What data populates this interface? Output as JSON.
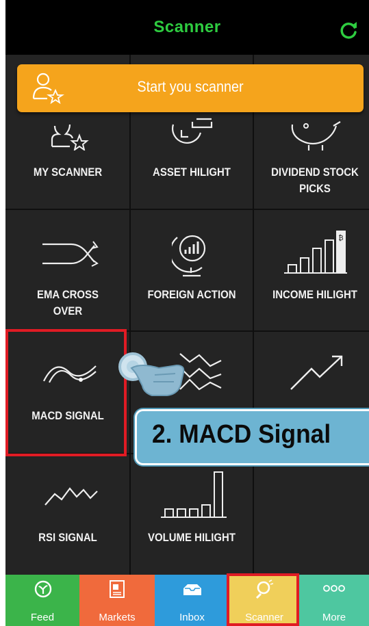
{
  "header": {
    "title": "Scanner"
  },
  "start_button": {
    "label": "Start you scanner"
  },
  "grid": {
    "items": [
      {
        "id": "my_scanner",
        "label": "MY SCANNER"
      },
      {
        "id": "asset_hilight",
        "label": "ASSET HILIGHT"
      },
      {
        "id": "dividend_stock_picks",
        "label_line1": "DIVIDEND STOCK",
        "label_line2": "PICKS"
      },
      {
        "id": "ema_cross_over",
        "label_line1": "EMA CROSS",
        "label_line2": "OVER"
      },
      {
        "id": "foreign_action",
        "label": "FOREIGN ACTION"
      },
      {
        "id": "income_hilight",
        "label": "INCOME HILIGHT"
      },
      {
        "id": "macd_signal",
        "label": "MACD SIGNAL"
      },
      {
        "id": "rsi_signal",
        "label": "RSI SIGNAL"
      },
      {
        "id": "volume_hilight",
        "label": "VOLUME HILIGHT"
      }
    ]
  },
  "callout": {
    "text": "2. MACD Signal"
  },
  "tabs": [
    {
      "label": "Feed",
      "color": "#3bb44a"
    },
    {
      "label": "Markets",
      "color": "#f06a3c"
    },
    {
      "label": "Inbox",
      "color": "#2e9bdb"
    },
    {
      "label": "Scanner",
      "color": "#f0cf5a"
    },
    {
      "label": "More",
      "color": "#4ec7a0"
    }
  ],
  "colors": {
    "accent": "#2ecc40",
    "start_button": "#f5a41c",
    "highlight": "#e01b24",
    "callout": "#6db4d2"
  }
}
